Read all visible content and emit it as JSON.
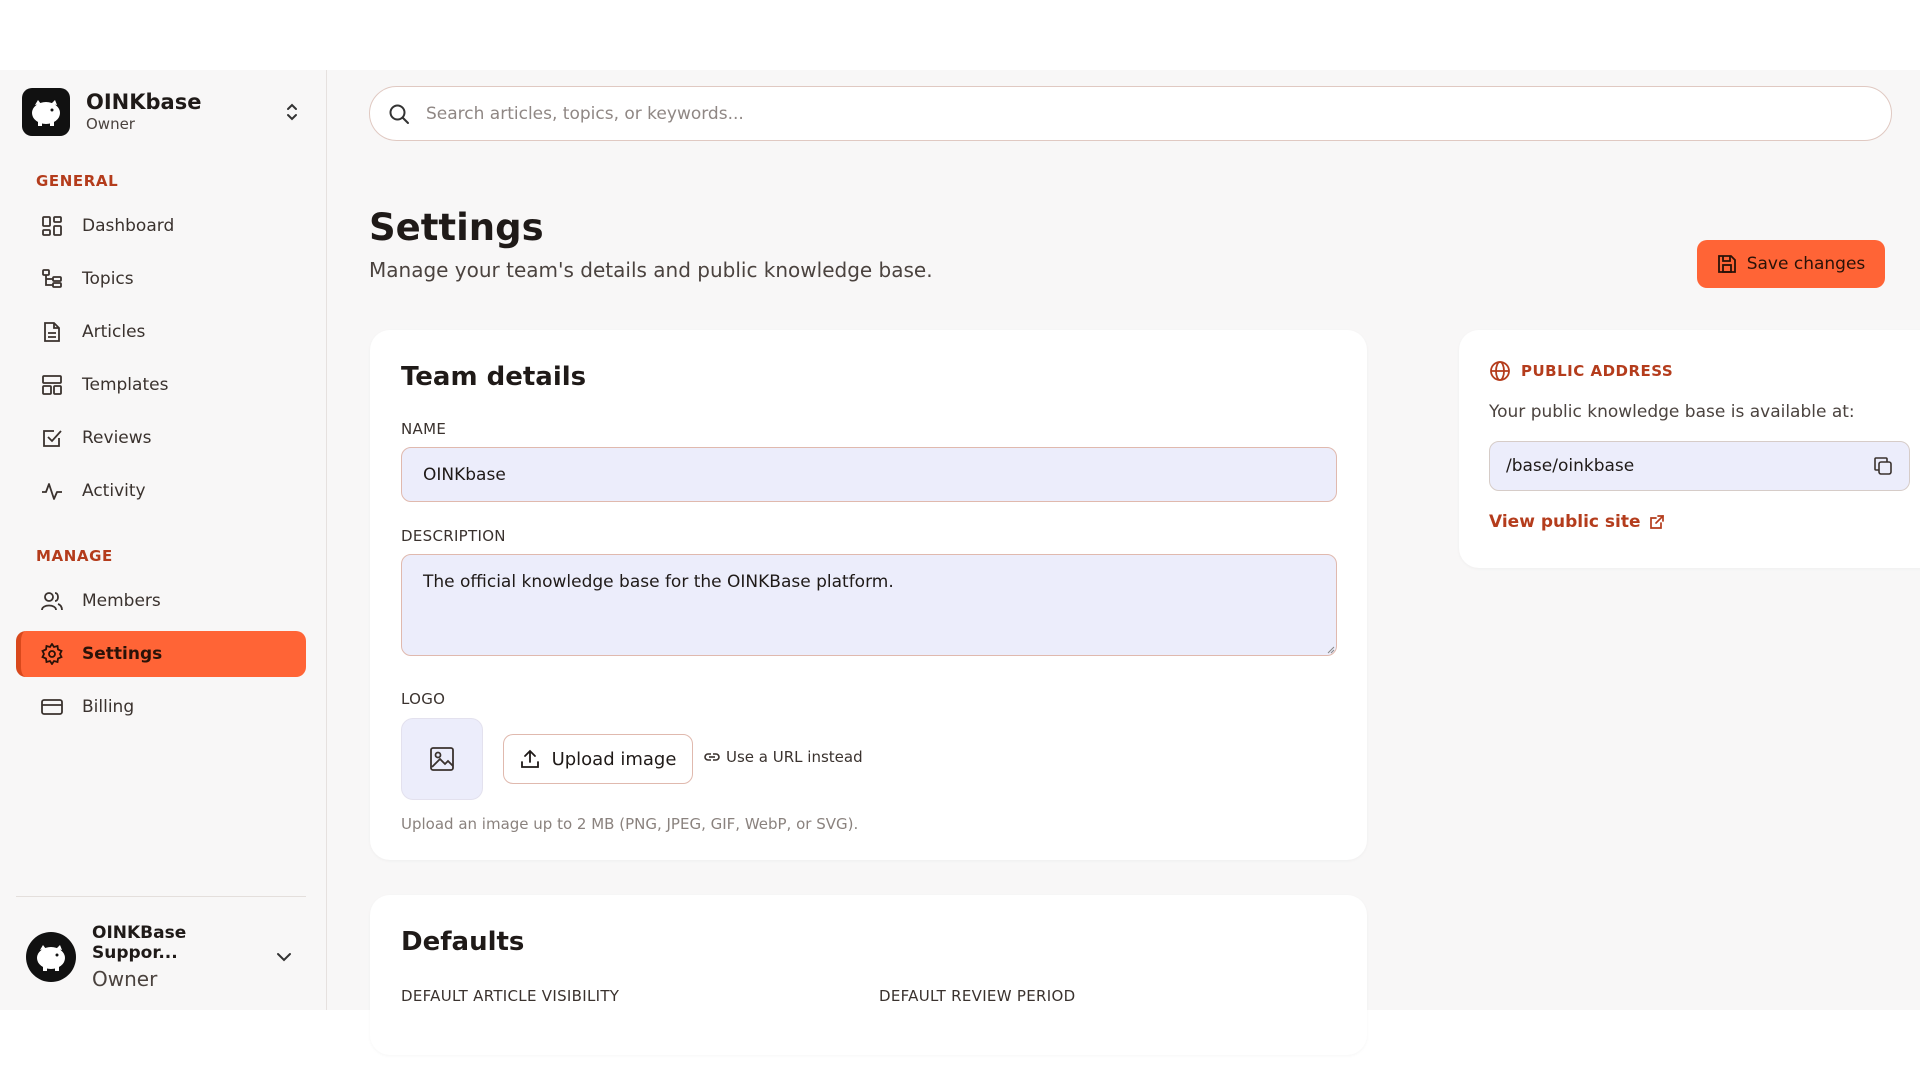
{
  "team": {
    "name": "OINKbase",
    "role": "Owner"
  },
  "sidebar": {
    "general_label": "GENERAL",
    "manage_label": "MANAGE",
    "general_items": [
      {
        "label": "Dashboard",
        "icon": "dashboard-icon"
      },
      {
        "label": "Topics",
        "icon": "topics-icon"
      },
      {
        "label": "Articles",
        "icon": "articles-icon"
      },
      {
        "label": "Templates",
        "icon": "templates-icon"
      },
      {
        "label": "Reviews",
        "icon": "reviews-icon"
      },
      {
        "label": "Activity",
        "icon": "activity-icon"
      }
    ],
    "manage_items": [
      {
        "label": "Members",
        "icon": "members-icon"
      },
      {
        "label": "Settings",
        "icon": "settings-icon",
        "active": true
      },
      {
        "label": "Billing",
        "icon": "billing-icon"
      }
    ]
  },
  "user": {
    "name": "OINKBase Suppor...",
    "role": "Owner"
  },
  "search": {
    "placeholder": "Search articles, topics, or keywords..."
  },
  "page": {
    "title": "Settings",
    "subtitle": "Manage your team's details and public knowledge base.",
    "save_label": "Save changes"
  },
  "team_details": {
    "title": "Team details",
    "name_label": "NAME",
    "name_value": "OINKbase",
    "description_label": "DESCRIPTION",
    "description_value": "The official knowledge base for the OINKBase platform.",
    "logo_label": "LOGO",
    "upload_label": "Upload image",
    "url_label": "Use a URL instead",
    "hint": "Upload an image up to 2 MB (PNG, JPEG, GIF, WebP, or SVG)."
  },
  "defaults": {
    "title": "Defaults",
    "visibility_label": "DEFAULT ARTICLE VISIBILITY",
    "review_label": "DEFAULT REVIEW PERIOD"
  },
  "public_address": {
    "title": "PUBLIC ADDRESS",
    "description": "Your public knowledge base is available at:",
    "path": "/base/oinkbase",
    "view_label": "View public site"
  },
  "colors": {
    "accent": "#ff6436",
    "accent_text": "#b43c1c",
    "field_bg": "#ecedfb"
  }
}
